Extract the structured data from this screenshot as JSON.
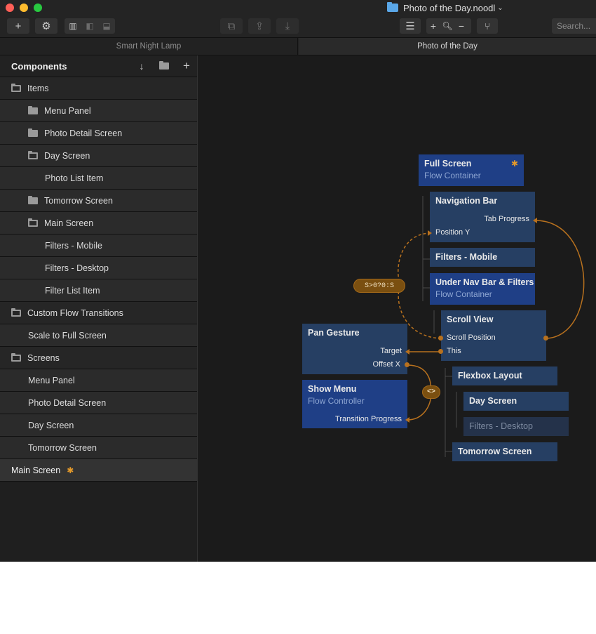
{
  "window": {
    "document_title": "Photo of the Day.noodl",
    "chevron": "⌄"
  },
  "toolbar": {
    "add_label": "+",
    "settings_icon": "gear-icon",
    "zoom_in_label": "+",
    "zoom_out_label": "−",
    "search_placeholder": "Search..."
  },
  "tabs": [
    {
      "label": "Smart Night Lamp"
    },
    {
      "label": "Photo of the Day"
    }
  ],
  "sidebar": {
    "title": "Components",
    "items": [
      {
        "label": "Items",
        "level": 0,
        "icon": "folder-open-icon"
      },
      {
        "label": "Menu Panel",
        "level": 1,
        "icon": "folder-icon"
      },
      {
        "label": "Photo Detail Screen",
        "level": 1,
        "icon": "folder-icon"
      },
      {
        "label": "Day Screen",
        "level": 1,
        "icon": "folder-open-icon"
      },
      {
        "label": "Photo List Item",
        "level": 2
      },
      {
        "label": "Tomorrow Screen",
        "level": 1,
        "icon": "folder-icon"
      },
      {
        "label": "Main Screen",
        "level": 1,
        "icon": "folder-open-icon"
      },
      {
        "label": "Filters - Mobile",
        "level": 2
      },
      {
        "label": "Filters - Desktop",
        "level": 2
      },
      {
        "label": "Filter List Item",
        "level": 2
      },
      {
        "label": "Custom Flow Transitions",
        "level": 0,
        "icon": "folder-open-icon"
      },
      {
        "label": "Scale to Full Screen",
        "level": 1
      },
      {
        "label": "Screens",
        "level": 0,
        "icon": "folder-open-icon"
      },
      {
        "label": "Menu Panel",
        "level": 1
      },
      {
        "label": "Photo Detail Screen",
        "level": 1
      },
      {
        "label": "Day Screen",
        "level": 1
      },
      {
        "label": "Tomorrow Screen",
        "level": 1
      },
      {
        "label": "Main Screen",
        "level": 0,
        "selected": true,
        "starred": true
      }
    ]
  },
  "canvas": {
    "nodes": {
      "full_screen": {
        "title": "Full Screen",
        "subtitle": "Flow Container",
        "star": "✱"
      },
      "navigation_bar": {
        "title": "Navigation Bar",
        "port_out": "Tab Progress",
        "port_in": "Position Y"
      },
      "filters_mobile": {
        "title": "Filters - Mobile"
      },
      "under_nav": {
        "title": "Under Nav Bar & Filters",
        "subtitle": "Flow Container"
      },
      "scroll_view": {
        "title": "Scroll View",
        "port_scroll": "Scroll Position",
        "port_this": "This"
      },
      "pan_gesture": {
        "title": "Pan Gesture",
        "port_target": "Target",
        "port_offset": "Offset X"
      },
      "show_menu": {
        "title": "Show Menu",
        "subtitle": "Flow Controller",
        "port_in": "Transition Progress"
      },
      "flexbox_layout": {
        "title": "Flexbox Layout"
      },
      "day_screen": {
        "title": "Day Screen"
      },
      "filters_desktop": {
        "title": "Filters - Desktop"
      },
      "tomorrow_screen": {
        "title": "Tomorrow Screen"
      }
    },
    "expression_label": "S>0?0:S",
    "inverse_label": "<>"
  },
  "colors": {
    "node": "#263f63",
    "visual_node": "#1f3f86",
    "wire": "#b8711e"
  }
}
